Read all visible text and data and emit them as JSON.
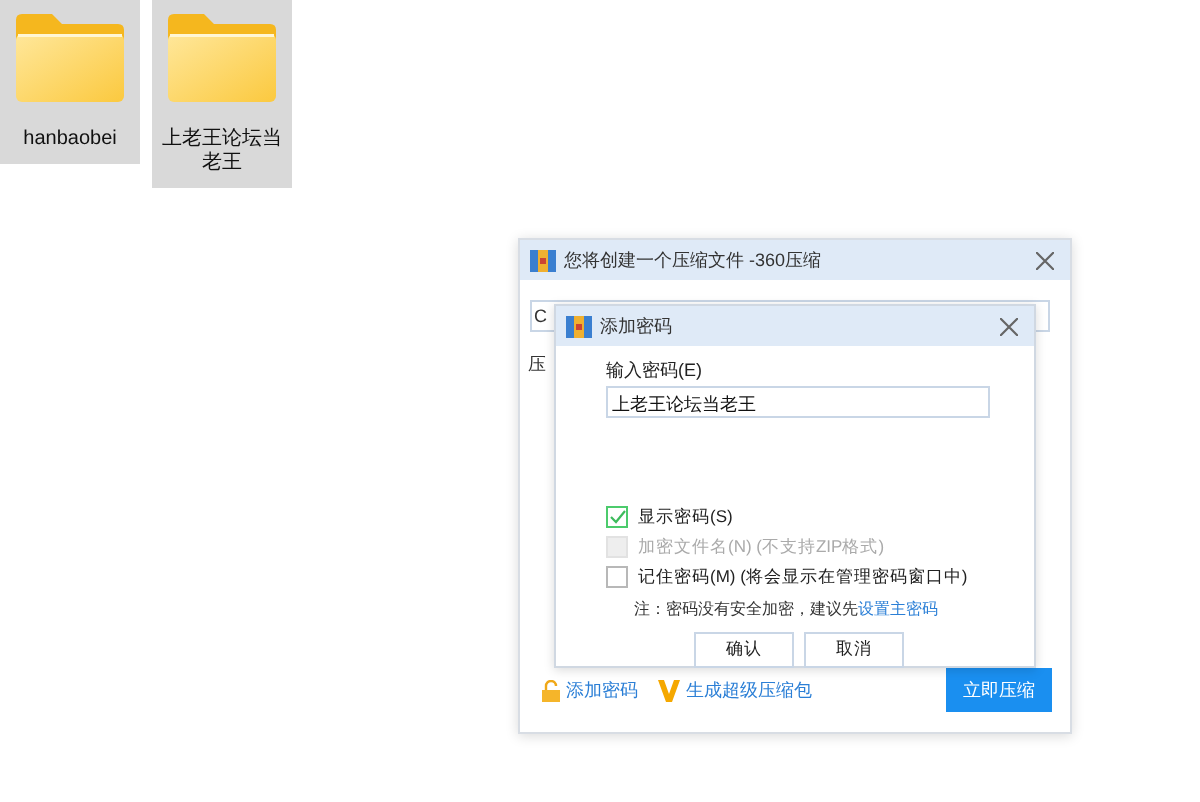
{
  "desktop_icons": [
    {
      "label": "hanbaobei",
      "selected": true
    },
    {
      "label": "上老王论坛当老王",
      "selected": true
    }
  ],
  "main_window": {
    "title": "您将创建一个压缩文件 -360压缩",
    "path_field": {
      "value": "C"
    },
    "label_1": "压",
    "links": [
      "添加密码",
      "生成超级压缩包"
    ],
    "primary_button": "立即压缩"
  },
  "password_dialog": {
    "title": "添加密码",
    "password_label": "输入密码(E)",
    "password_value": "上老王论坛当老王",
    "options": [
      {
        "label": "显示密码(S)",
        "checked": true,
        "disabled": false
      },
      {
        "label": "加密文件名(N) (不支持ZIP格式)",
        "checked": false,
        "disabled": true
      },
      {
        "label": "记住密码(M) (将会显示在管理密码窗口中)",
        "checked": false,
        "disabled": false
      }
    ],
    "note": "注：密码没有安全加密，建议先",
    "note_link": "设置主密码",
    "buttons": [
      "确认",
      "取消"
    ]
  }
}
